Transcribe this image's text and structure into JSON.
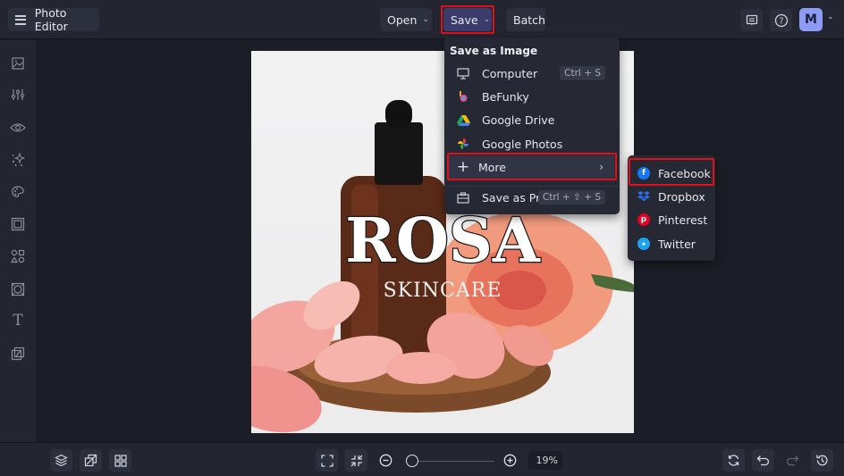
{
  "header": {
    "app_title": "Photo Editor",
    "open_label": "Open",
    "save_label": "Save",
    "batch_label": "Batch",
    "avatar_initial": "M"
  },
  "save_menu": {
    "heading": "Save as Image",
    "items": [
      {
        "label": "Computer",
        "shortcut": "Ctrl + S",
        "icon": "monitor-icon"
      },
      {
        "label": "BeFunky",
        "icon": "befunky-icon"
      },
      {
        "label": "Google Drive",
        "icon": "google-drive-icon"
      },
      {
        "label": "Google Photos",
        "icon": "google-photos-icon"
      },
      {
        "label": "More",
        "icon": "plus-icon",
        "highlighted": true
      },
      {
        "label": "Save as Project",
        "shortcut": "Ctrl + ⇧ + S",
        "icon": "briefcase-icon"
      }
    ]
  },
  "more_submenu": {
    "items": [
      {
        "label": "Facebook",
        "icon": "facebook-icon",
        "color": "#1877f2",
        "highlighted": true
      },
      {
        "label": "Dropbox",
        "icon": "dropbox-icon",
        "color": "#0061ff"
      },
      {
        "label": "Pinterest",
        "icon": "pinterest-icon",
        "color": "#e60023"
      },
      {
        "label": "Twitter",
        "icon": "twitter-icon",
        "color": "#1da1f2"
      }
    ]
  },
  "sidebar": {
    "tools": [
      "image-icon",
      "adjust-sliders-icon",
      "eye-icon",
      "sparkle-effects-icon",
      "palette-icon",
      "frame-icon",
      "shapes-icon",
      "texture-icon",
      "text-icon",
      "overlay-icon"
    ]
  },
  "canvas": {
    "title_text": "ROSA",
    "subtitle_text": "SKINCARE"
  },
  "bottom": {
    "zoom_value": "19%",
    "zoom_fraction": 0.02
  },
  "colors": {
    "accent": "#8c9bf4",
    "highlight_border": "#e0101a",
    "save_bg": "#3c3c6c"
  }
}
